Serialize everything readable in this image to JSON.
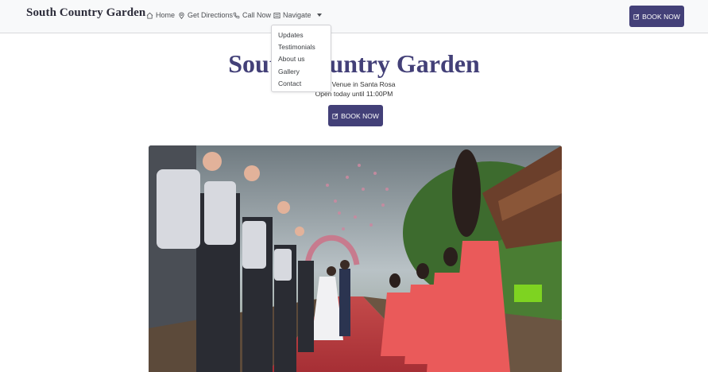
{
  "navbar": {
    "brand": "South Country Garden",
    "links": [
      {
        "label": "Home",
        "icon": "home-icon"
      },
      {
        "label": "Get Directions",
        "icon": "map-pin-icon"
      },
      {
        "label": "Call Now",
        "icon": "phone-icon"
      },
      {
        "label": "Navigate",
        "icon": "list-icon"
      }
    ],
    "book_label": "BOOK NOW"
  },
  "dropdown": {
    "items": [
      "Updates",
      "Testimonials",
      "About us",
      "Gallery",
      "Contact"
    ]
  },
  "hero": {
    "title": "South Country Garden",
    "subtitle_line1": "Event Venue in Santa Rosa",
    "subtitle_line2": "Open today until 11:00PM",
    "book_label": "BOOK NOW"
  },
  "colors": {
    "accent": "#434078",
    "navbar_bg": "#f8f9fa"
  }
}
